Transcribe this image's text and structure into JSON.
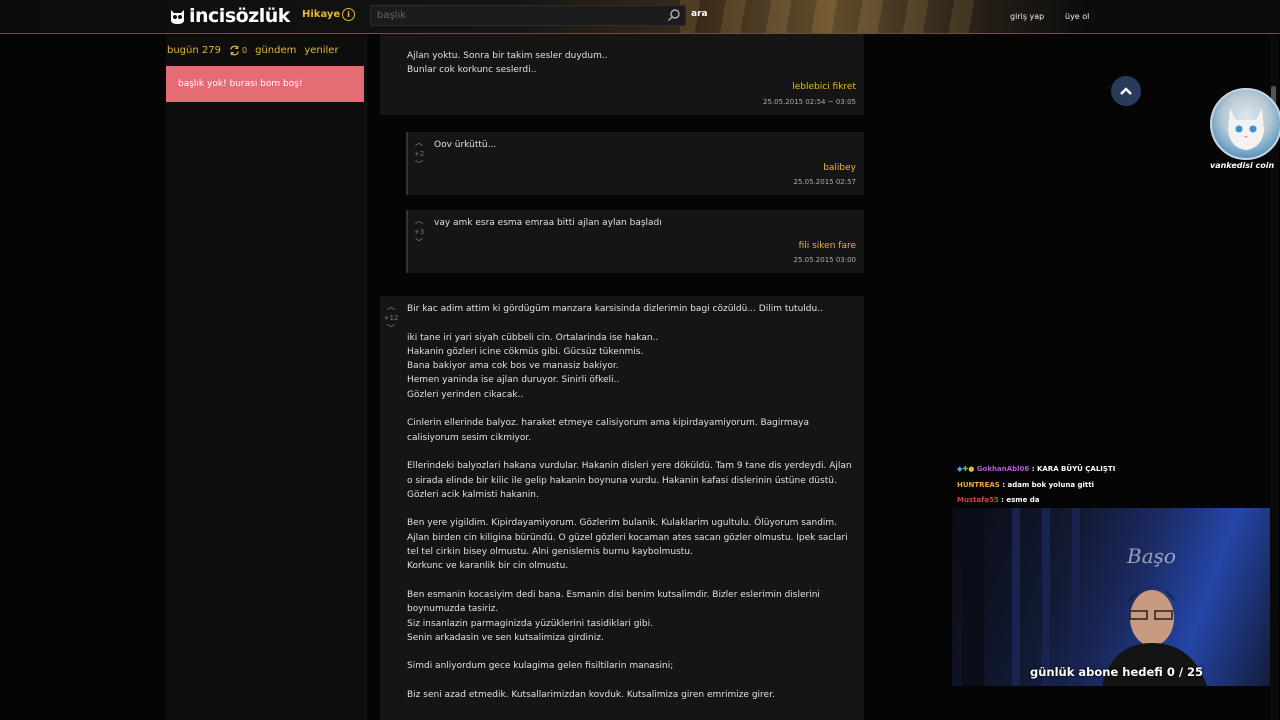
{
  "header": {
    "logo_text": "incisözlük",
    "hikaye_label": "Hikaye",
    "search_placeholder": "başlık",
    "search_button": "ara",
    "login_label": "giriş yap",
    "signup_label": "üye ol",
    "banner_icon": "owl-icon"
  },
  "left": {
    "today_label": "bugün 279",
    "refresh_count": "0",
    "gundem_label": "gündem",
    "yeniler_label": "yeniler",
    "empty_message": "başlık yok! burası bom boş!"
  },
  "entries": [
    {
      "text": "Ajlan yoktu. Sonra bir takim sesler duydum..\nBunlar cok korkunc seslerdi..",
      "author": "leblebici fikret",
      "date": "25.05.2015 02:54 ~ 03:05"
    },
    {
      "text": "Oov ürküttü...",
      "votes": "+2",
      "author": "balibey",
      "date": "25.05.2015 02:57"
    },
    {
      "text": "vay amk esra esma emraa bitti ajlan aylan başladı",
      "votes": "+3",
      "author": "fili siken fare",
      "date": "25.05.2015 03:00"
    },
    {
      "votes": "+12",
      "text": "Bir kac adim attim ki gördügüm manzara karsisinda dizlerimin bagi cözüldü... Dilim tutuldu..\n\niki tane iri yari siyah cübbeli cin. Ortalarinda ise hakan..\nHakanin gözleri icine cökmüs gibi. Gücsüz tükenmis.\nBana bakiyor ama cok bos ve manasiz bakiyor.\nHemen yaninda ise ajlan duruyor. Sinirli öfkeli..\nGözleri yerinden cikacak..\n\nCinlerin ellerinde balyoz. haraket etmeye calisiyorum ama kipirdayamiyorum. Bagirmaya\ncalisiyorum sesim cikmiyor.\n\nEllerindeki balyozlari hakana vurdular. Hakanin disleri yere döküldü. Tam 9 tane dis yerdeydi. Ajlan\no sirada elinde bir kilic ile gelip hakanin boynuna vurdu. Hakanin kafasi dislerinin üstüne düstü.\nGözleri acik kalmisti hakanin.\n\nBen yere yigildim. Kipirdayamiyorum. Gözlerim bulanik. Kulaklarim ugultulu. Ölüyorum sandim.\nAjlan birden cin kiligina büründü. O güzel gözleri kocaman ates sacan gözler olmustu. Ipek saclari\ntel tel cirkin bisey olmustu. Alni genislemis burnu kaybolmustu.\nKorkunc ve karanlik bir cin olmustu.\n\nBen esmanin kocasiyim dedi bana. Esmanin disi benim kutsalimdir. Bizler eslerimin dislerini\nboynumuzda tasiriz.\nSiz insanlazin parmaginizda yüzüklerini tasidiklari gibi.\nSenin arkadasin ve sen kutsalimiza girdiniz.\n\nSimdi anliyordum gece kulagima gelen fisiltilarin manasini;\n\nBiz seni azad etmedik. Kutsallarimizdan kovduk. Kutsalimiza giren emrimize girer."
    }
  ],
  "overlay": {
    "cat_name": "vankedisi coin",
    "chat": [
      {
        "user": "GokhanAbl06",
        "msg": " : KARA BÜYÜ ÇALIŞTI"
      },
      {
        "user": "HUNTREAS",
        "msg": " : adam bok yoluna gitti"
      },
      {
        "user": "Mustafa55",
        "msg": " : esme da"
      }
    ],
    "goal_text": "günlük abone hedefi 0 / 25",
    "colors": {
      "accent": "#e8b830",
      "empty_box": "#e46d75"
    }
  }
}
